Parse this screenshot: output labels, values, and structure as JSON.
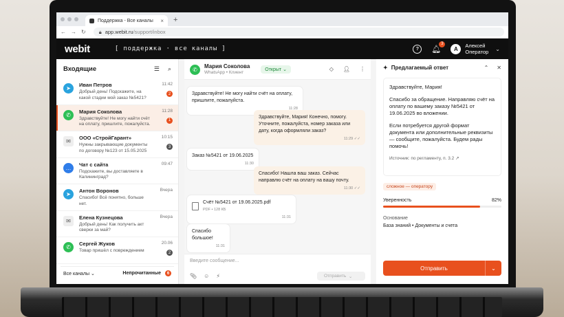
{
  "browser": {
    "tab_title": "Поддержка - Все каналы",
    "tab_close": "×",
    "new_tab": "+",
    "url_host": "app.webit.ru",
    "url_path": "/support/inbox"
  },
  "app": {
    "logo": "webit",
    "section": "[ поддержка · все каналы ]",
    "help_icon": "?",
    "notifications_count": "3",
    "user_initial": "А",
    "user_name": "Алексей",
    "user_role": "Оператор"
  },
  "inbox": {
    "title": "Входящие",
    "conversations": [
      {
        "channel": "telegram",
        "name": "Иван Петров",
        "text": "Добрый день! Подскажите, на какой стадии мой заказ №5421?",
        "time": "11:42",
        "badge": "2",
        "badge_color": "orange"
      },
      {
        "channel": "whatsapp",
        "name": "Мария Соколова",
        "text": "Здравствуйте! Не могу найти счёт на оплату, пришлите, пожалуйста.",
        "time": "11:28",
        "badge": "1",
        "badge_color": "orange"
      },
      {
        "channel": "email",
        "name": "ООО «СтройГарант»",
        "text": "Нужны закрывающие документы по договору №123 от 15.05.2025",
        "time": "10:15",
        "badge": "3",
        "badge_color": "gray"
      },
      {
        "channel": "chat",
        "name": "Чат с сайта",
        "text": "Подскажите, вы доставляете в Калининград?",
        "time": "09:47",
        "badge": "",
        "badge_color": ""
      },
      {
        "channel": "telegram",
        "name": "Антон Воронов",
        "text": "Спасибо! Всё понятно, больше нет.",
        "time": "Вчера",
        "badge": "",
        "badge_color": ""
      },
      {
        "channel": "email",
        "name": "Елена Кузнецова",
        "text": "Добрый день! Как получить акт сверки за май?",
        "time": "Вчера",
        "badge": "",
        "badge_color": ""
      },
      {
        "channel": "whatsapp",
        "name": "Сергей Жуков",
        "text": "Товар пришёл с повреждением",
        "time": "20.06",
        "badge": "2",
        "badge_color": "gray"
      }
    ],
    "filter_label": "Все каналы",
    "unread_label": "Непрочитанные",
    "unread_count": "6"
  },
  "chat": {
    "name": "Мария Соколова",
    "sub": "WhatsApp • Клиент",
    "status": "Открыт",
    "messages": [
      {
        "dir": "in",
        "text": "Здравствуйте! Не могу найти счёт на оплату, пришлите, пожалуйста.",
        "time": "11:28"
      },
      {
        "dir": "out",
        "text": "Здравствуйте, Мария! Конечно, помогу. Уточните, пожалуйста, номер заказа или дату, когда оформляли заказ?",
        "time": "11:29"
      },
      {
        "dir": "in",
        "text": "Заказ №5421 от 19.06.2025",
        "time": "11:30"
      },
      {
        "dir": "out",
        "text": "Спасибо! Нашла ваш заказ. Сейчас направлю счёт на оплату на вашу почту.",
        "time": "11:30"
      },
      {
        "dir": "in",
        "file": "Счёт №5421 от 19.06.2025.pdf",
        "file_meta": "PDF • 128 КБ",
        "time": "11:31"
      },
      {
        "dir": "in",
        "text": "Спасибо большое!",
        "time": "11:31"
      }
    ],
    "composer_placeholder": "Введите сообщение...",
    "send_label": "Отправить"
  },
  "suggest": {
    "title": "Предлагаемый ответ",
    "greeting": "Здравствуйте, Мария!",
    "para1": "Спасибо за обращение. Направляю счёт на оплату по вашему заказу №5421 от 19.06.2025 во вложении.",
    "para2": "Если потребуется другой формат документа или дополнительные реквизиты — сообщите, пожалуйста. Будем рады помочь!",
    "source": "Источник: по регламенту, п. 3.2",
    "complexity": "сложное — оператору",
    "confidence_label": "Уверенность",
    "confidence_value": "82%",
    "confidence": 0.82,
    "basis_label": "Основание",
    "basis_value": "База знаний • Документы и счета",
    "send_label": "Отправить"
  },
  "colors": {
    "accent": "#e8501e",
    "telegram": "#2aa3de",
    "whatsapp": "#2dbf55"
  }
}
